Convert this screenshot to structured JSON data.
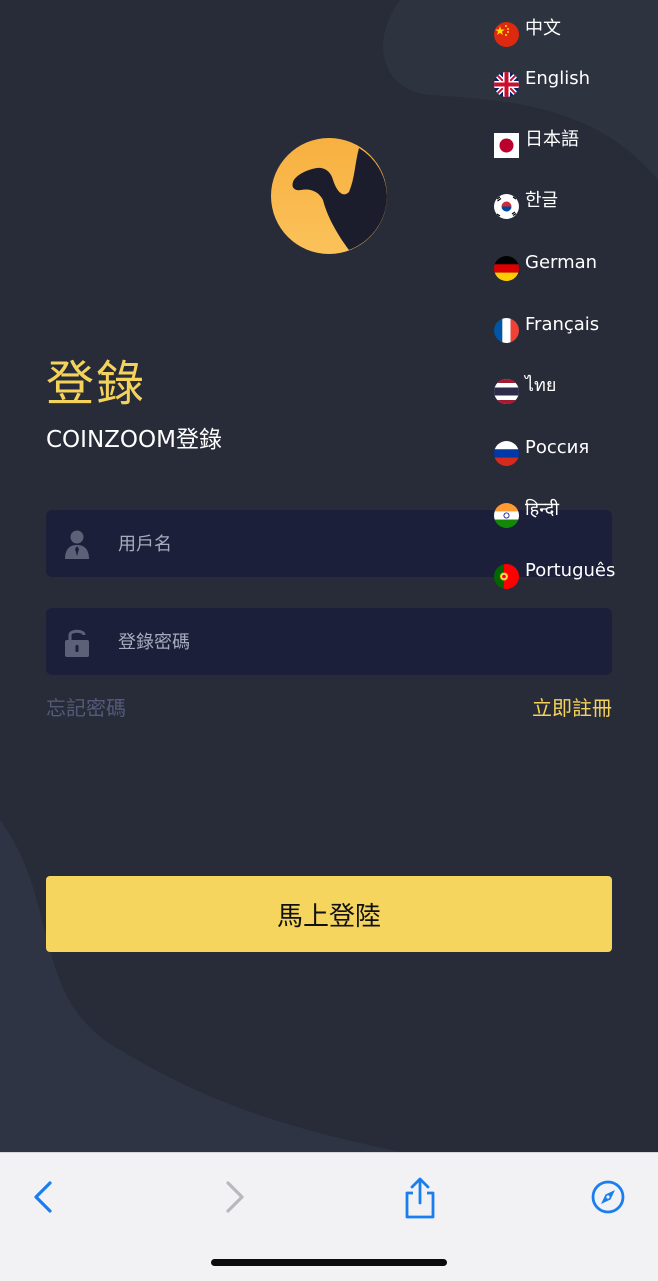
{
  "login": {
    "title": "登錄",
    "subtitle": "COINZOOM登錄",
    "username_placeholder": "用戶名",
    "password_placeholder": "登錄密碼",
    "forgot_password": "忘記密碼",
    "register": "立即註冊",
    "submit": "馬上登陸"
  },
  "languages": [
    {
      "label": "中文",
      "flag": "china-flag-icon"
    },
    {
      "label": "English",
      "flag": "uk-flag-icon"
    },
    {
      "label": "日本語",
      "flag": "japan-flag-icon"
    },
    {
      "label": "한글",
      "flag": "korea-flag-icon"
    },
    {
      "label": "German",
      "flag": "germany-flag-icon"
    },
    {
      "label": "Français",
      "flag": "france-flag-icon"
    },
    {
      "label": "ไทย",
      "flag": "thailand-flag-icon"
    },
    {
      "label": "Россия",
      "flag": "russia-flag-icon"
    },
    {
      "label": "हिन्दी",
      "flag": "india-flag-icon"
    },
    {
      "label": "Português",
      "flag": "portugal-flag-icon"
    }
  ],
  "icons": {
    "logo": "camel-logo-icon",
    "username": "user-icon",
    "password": "lock-icon",
    "back": "chevron-left-icon",
    "forward": "chevron-right-icon",
    "share": "share-icon",
    "browser": "compass-icon"
  },
  "colors": {
    "background": "#272c38",
    "accent": "#f5d35b",
    "field": "#1c1f3a",
    "ios_blue": "#1a7ef0"
  }
}
